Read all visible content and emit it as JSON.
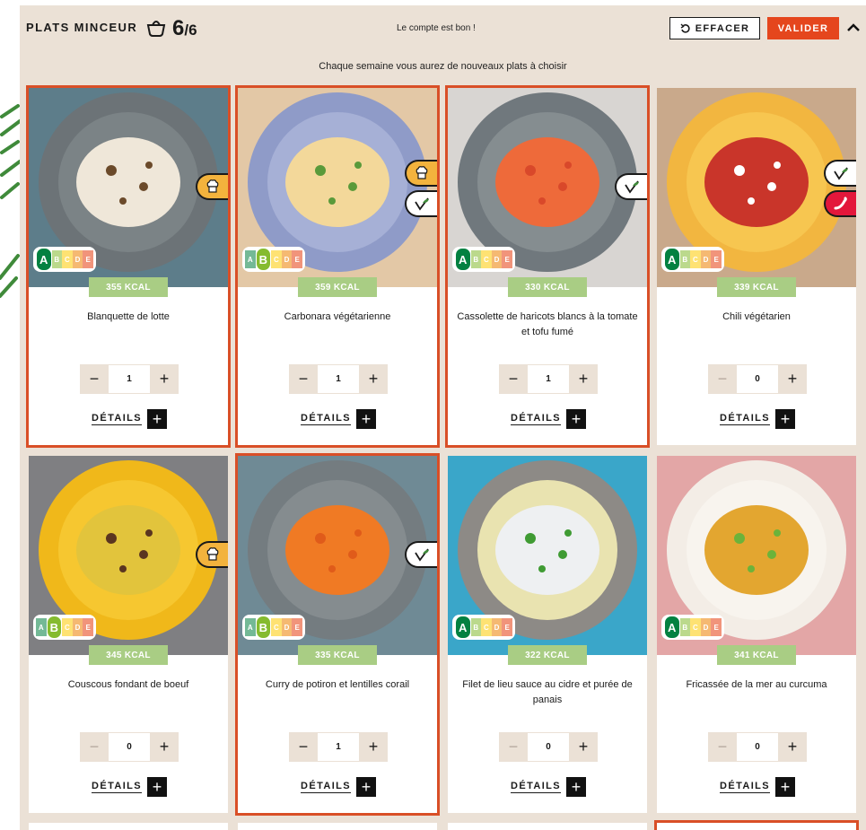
{
  "header": {
    "title": "PLATS MINCEUR",
    "count": "6",
    "count_total": "/6",
    "status": "Le compte est bon !",
    "clear_label": "EFFACER",
    "validate_label": "VALIDER"
  },
  "subtitle": "Chaque semaine vous aurez de nouveaux plats à choisir",
  "details_label": "DÉTAILS",
  "colors": {
    "accent": "#e5461d",
    "selected_border": "#d94f27",
    "panel": "#ebe1d6",
    "kcal": "#a9cd84"
  },
  "meals": [
    {
      "name": "Blanquette de lotte",
      "kcal": "355 KCAL",
      "qty": "1",
      "nutriscore": "A",
      "selected": true,
      "badges": [
        "chef-icon"
      ]
    },
    {
      "name": "Carbonara végétarienne",
      "kcal": "359 KCAL",
      "qty": "1",
      "nutriscore": "B",
      "selected": true,
      "badges": [
        "chef-icon",
        "veggie-icon"
      ]
    },
    {
      "name": "Cassolette de haricots blancs à la tomate et tofu fumé",
      "kcal": "330 KCAL",
      "qty": "1",
      "nutriscore": "A",
      "selected": true,
      "badges": [
        "veggie-icon"
      ]
    },
    {
      "name": "Chili végétarien",
      "kcal": "339 KCAL",
      "qty": "0",
      "nutriscore": "A",
      "selected": false,
      "badges": [
        "veggie-icon",
        "spicy-icon"
      ]
    },
    {
      "name": "Couscous fondant de boeuf",
      "kcal": "345 KCAL",
      "qty": "0",
      "nutriscore": "B",
      "selected": false,
      "badges": [
        "chef-icon"
      ]
    },
    {
      "name": "Curry de potiron et lentilles corail",
      "kcal": "335 KCAL",
      "qty": "1",
      "nutriscore": "B",
      "selected": true,
      "badges": [
        "veggie-icon"
      ]
    },
    {
      "name": "Filet de lieu sauce au cidre et purée de panais",
      "kcal": "322 KCAL",
      "qty": "0",
      "nutriscore": "A",
      "selected": false,
      "badges": []
    },
    {
      "name": "Fricassée de la mer au curcuma",
      "kcal": "341 KCAL",
      "qty": "0",
      "nutriscore": "A",
      "selected": false,
      "badges": []
    }
  ]
}
